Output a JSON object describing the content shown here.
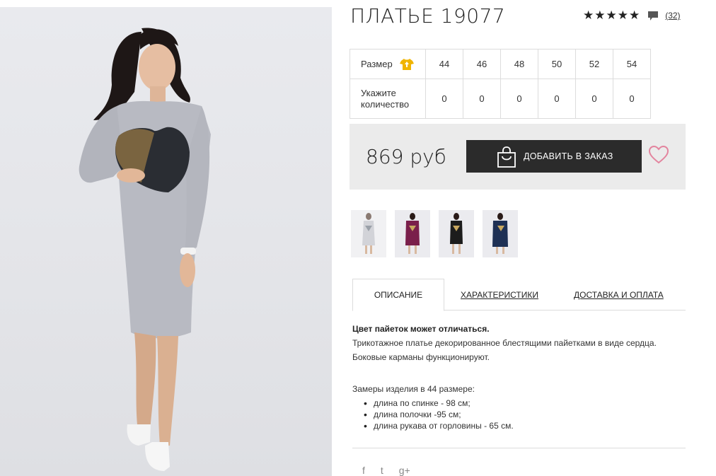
{
  "product": {
    "title": "ПЛАТЬЕ 19077",
    "stars": "★★★★★",
    "review_count": "(32)"
  },
  "size_table": {
    "size_label": "Размер",
    "qty_label": "Укажите количество",
    "sizes": [
      "44",
      "46",
      "48",
      "50",
      "52",
      "54"
    ],
    "quantities": [
      "0",
      "0",
      "0",
      "0",
      "0",
      "0"
    ]
  },
  "purchase": {
    "price": "869 руб",
    "add_button": "ДОБАВИТЬ В ЗАКАЗ"
  },
  "thumbnails": [
    {
      "color": "#d9d9dc",
      "name": "thumbnail-gray"
    },
    {
      "color": "#7a1f4b",
      "name": "thumbnail-burgundy"
    },
    {
      "color": "#1c1c1c",
      "name": "thumbnail-black"
    },
    {
      "color": "#1e3054",
      "name": "thumbnail-navy"
    }
  ],
  "tabs": {
    "description": "ОПИСАНИЕ",
    "characteristics": "ХАРАКТЕРИСТИКИ",
    "delivery": "ДОСТАВКА И ОПЛАТА"
  },
  "description": {
    "note": "Цвет пайеток может отличаться.",
    "text": "Трикотажное платье декорированное блестящими пайетками в виде сердца. Боковые карманы функционируют.",
    "measure_title": "Замеры изделия в 44 размере:",
    "measures": [
      "длина по спинке - 98 см;",
      "длина полочки -95 см;",
      "длина рукава от горловины - 65 см."
    ]
  },
  "social": {
    "facebook": "f",
    "twitter": "t",
    "gplus": "g+"
  },
  "colors": {
    "button_bg": "#2b2b2b",
    "heart": "#e3849e",
    "shirt_icon": "#f0b400"
  }
}
